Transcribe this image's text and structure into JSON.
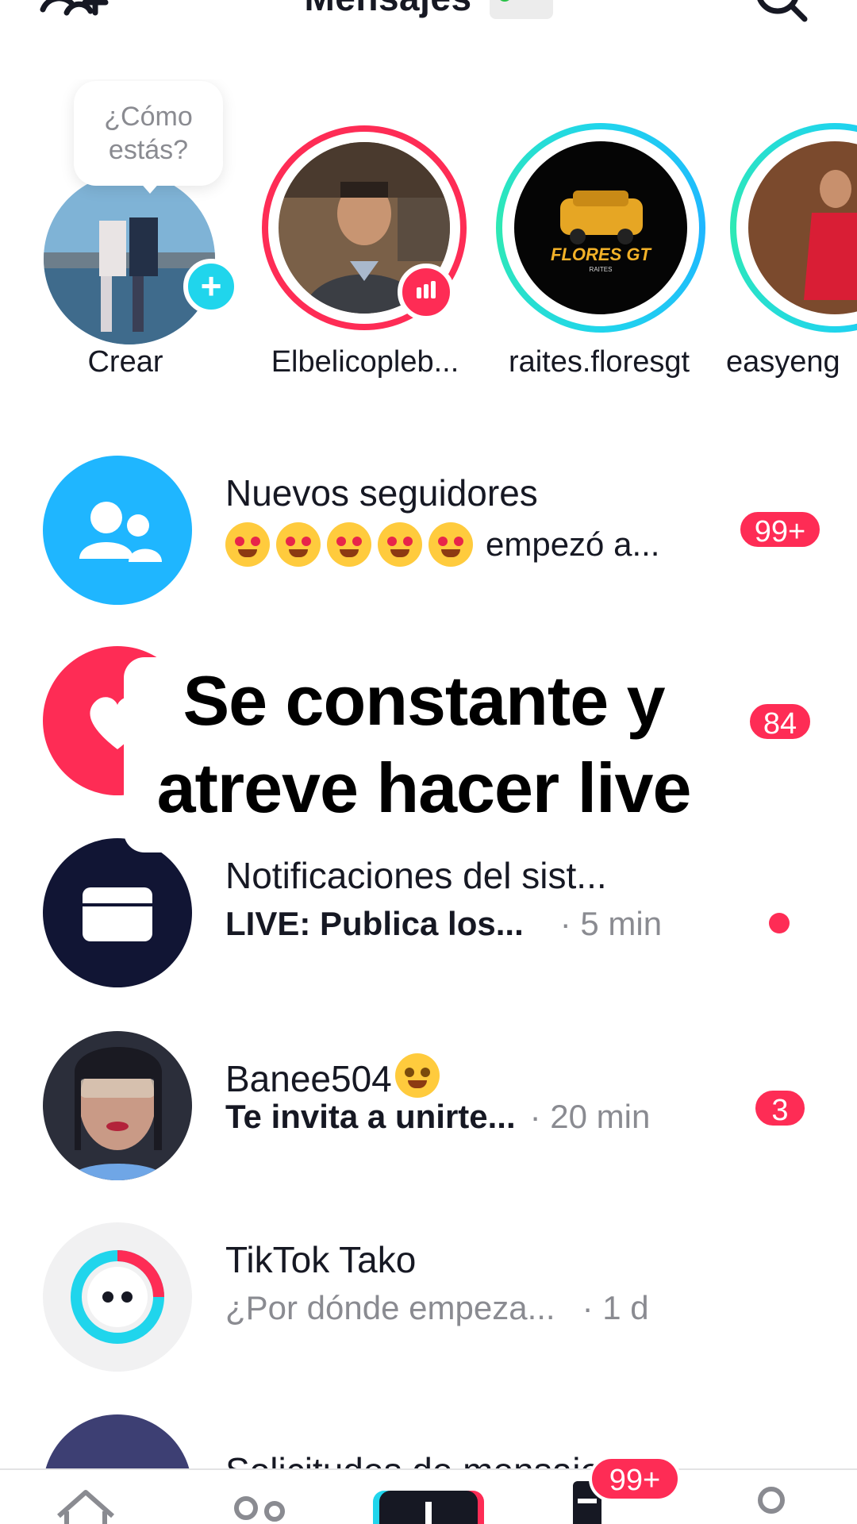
{
  "header": {
    "title": "Mensajes",
    "add_friends_icon": "add-person-icon",
    "search_icon": "search-icon"
  },
  "stories": {
    "note_bubble": "¿Cómo estás?",
    "items": [
      {
        "label": "Crear"
      },
      {
        "label": "Elbelicopleb..."
      },
      {
        "label": "raites.floresgt",
        "logo_text": "FLORES GT",
        "logo_sub": "RAITES"
      },
      {
        "label": "easyeng"
      }
    ]
  },
  "conversations": [
    {
      "name": "Nuevos seguidores",
      "preview": "empezó a...",
      "badge": "99+"
    },
    {
      "name": "",
      "preview": "",
      "badge": "84"
    },
    {
      "name": "Notificaciones del sist...",
      "preview": "LIVE: Publica los...",
      "time": "· 5 min"
    },
    {
      "name": "Banee504",
      "preview": "Te invita a unirte...",
      "time": "· 20 min",
      "badge": "3"
    },
    {
      "name": "TikTok Tako",
      "preview": "¿Por dónde empeza...",
      "time": "· 1 d"
    },
    {
      "name": "Solicitudes de mensajes"
    }
  ],
  "overlay_caption": {
    "line1": "Se constante y",
    "line2": "atreve hacer live"
  },
  "bottom_nav": {
    "inbox_badge": "99+"
  },
  "colors": {
    "accent_red": "#fe2c55",
    "accent_cyan": "#20d5ec",
    "followers_blue": "#1fb6ff",
    "system_navy": "#111534"
  }
}
